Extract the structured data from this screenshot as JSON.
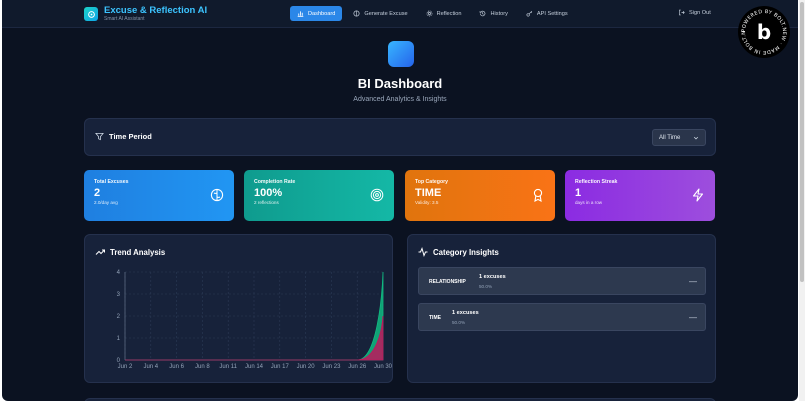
{
  "header": {
    "title": "Excuse & Reflection AI",
    "subtitle": "Smart AI Assistant",
    "nav": [
      {
        "label": "Dashboard",
        "icon": "bar-chart-icon",
        "active": true
      },
      {
        "label": "Generate Excuse",
        "icon": "brain-icon",
        "active": false
      },
      {
        "label": "Reflection",
        "icon": "gear-icon",
        "active": false
      },
      {
        "label": "History",
        "icon": "history-icon",
        "active": false
      },
      {
        "label": "API Settings",
        "icon": "key-icon",
        "active": false
      }
    ],
    "signout": "Sign Out"
  },
  "badge": {
    "text": "POWERED BY BOLT.NEW · MADE IN BOLT.NEW ·",
    "letter": "b"
  },
  "hero": {
    "title": "BI Dashboard",
    "subtitle": "Advanced Analytics & Insights"
  },
  "time_period": {
    "label": "Time Period",
    "selected": "All Time"
  },
  "stats": [
    {
      "label": "Total Excuses",
      "value": "2",
      "note": "2.0/day avg",
      "icon": "brain-icon"
    },
    {
      "label": "Completion Rate",
      "value": "100%",
      "note": "2 reflections",
      "icon": "target-icon"
    },
    {
      "label": "Top Category",
      "value": "TIME",
      "note": "Validity: 3.5",
      "icon": "award-icon"
    },
    {
      "label": "Reflection Streak",
      "value": "1",
      "note": "days in a row",
      "icon": "bolt-icon"
    }
  ],
  "trend": {
    "title": "Trend Analysis"
  },
  "insights": {
    "title": "Category Insights",
    "rows": [
      {
        "category": "RELATIONSHIP",
        "main": "1 excuses",
        "sub": "50.0%",
        "trend": "—"
      },
      {
        "category": "TIME",
        "main": "1 excuses",
        "sub": "50.0%",
        "trend": "—"
      }
    ]
  },
  "chart_data": {
    "type": "area",
    "title": "Trend Analysis",
    "categories": [
      "Jun 2",
      "Jun 4",
      "Jun 6",
      "Jun 8",
      "Jun 11",
      "Jun 14",
      "Jun 17",
      "Jun 20",
      "Jun 23",
      "Jun 26",
      "Jun 30"
    ],
    "ylim": [
      0,
      4
    ],
    "yticks": [
      0,
      1,
      2,
      3,
      4
    ],
    "series": [
      {
        "color": "#10b981",
        "values": [
          0,
          0,
          0,
          0,
          0,
          0,
          0,
          0,
          0,
          0,
          4
        ]
      },
      {
        "color": "#be185d",
        "values": [
          0,
          0,
          0,
          0,
          0,
          0,
          0,
          0,
          0,
          0,
          2
        ]
      }
    ],
    "grid": true
  }
}
